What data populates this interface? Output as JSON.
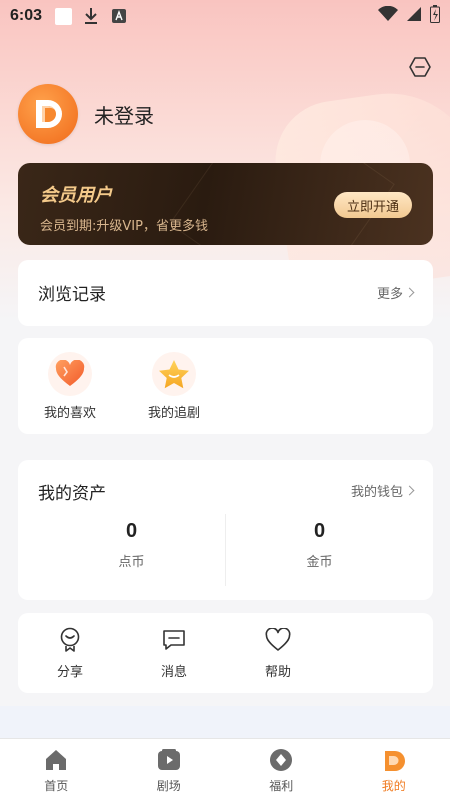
{
  "status_bar": {
    "time": "6:03"
  },
  "profile": {
    "login_text": "未登录"
  },
  "vip": {
    "title": "会员用户",
    "subtitle": "会员到期:升级VIP，省更多钱",
    "button_label": "立即开通",
    "accent_color": "#f3c98a"
  },
  "history": {
    "title": "浏览记录",
    "more_label": "更多"
  },
  "quick": {
    "items": [
      {
        "label": "我的喜欢",
        "icon": "heart-icon"
      },
      {
        "label": "我的追剧",
        "icon": "star-icon"
      }
    ]
  },
  "assets": {
    "title": "我的资产",
    "wallet_label": "我的钱包",
    "items": [
      {
        "value": "0",
        "label": "点币"
      },
      {
        "value": "0",
        "label": "金币"
      }
    ]
  },
  "tools": {
    "items": [
      {
        "label": "分享",
        "icon": "share-icon"
      },
      {
        "label": "消息",
        "icon": "message-icon"
      },
      {
        "label": "帮助",
        "icon": "help-heart-icon"
      }
    ]
  },
  "tabbar": {
    "active_color": "#f07a1f",
    "items": [
      {
        "label": "首页",
        "icon": "home-icon"
      },
      {
        "label": "剧场",
        "icon": "theater-icon"
      },
      {
        "label": "福利",
        "icon": "welfare-icon"
      },
      {
        "label": "我的",
        "icon": "profile-icon",
        "active": true
      }
    ]
  }
}
